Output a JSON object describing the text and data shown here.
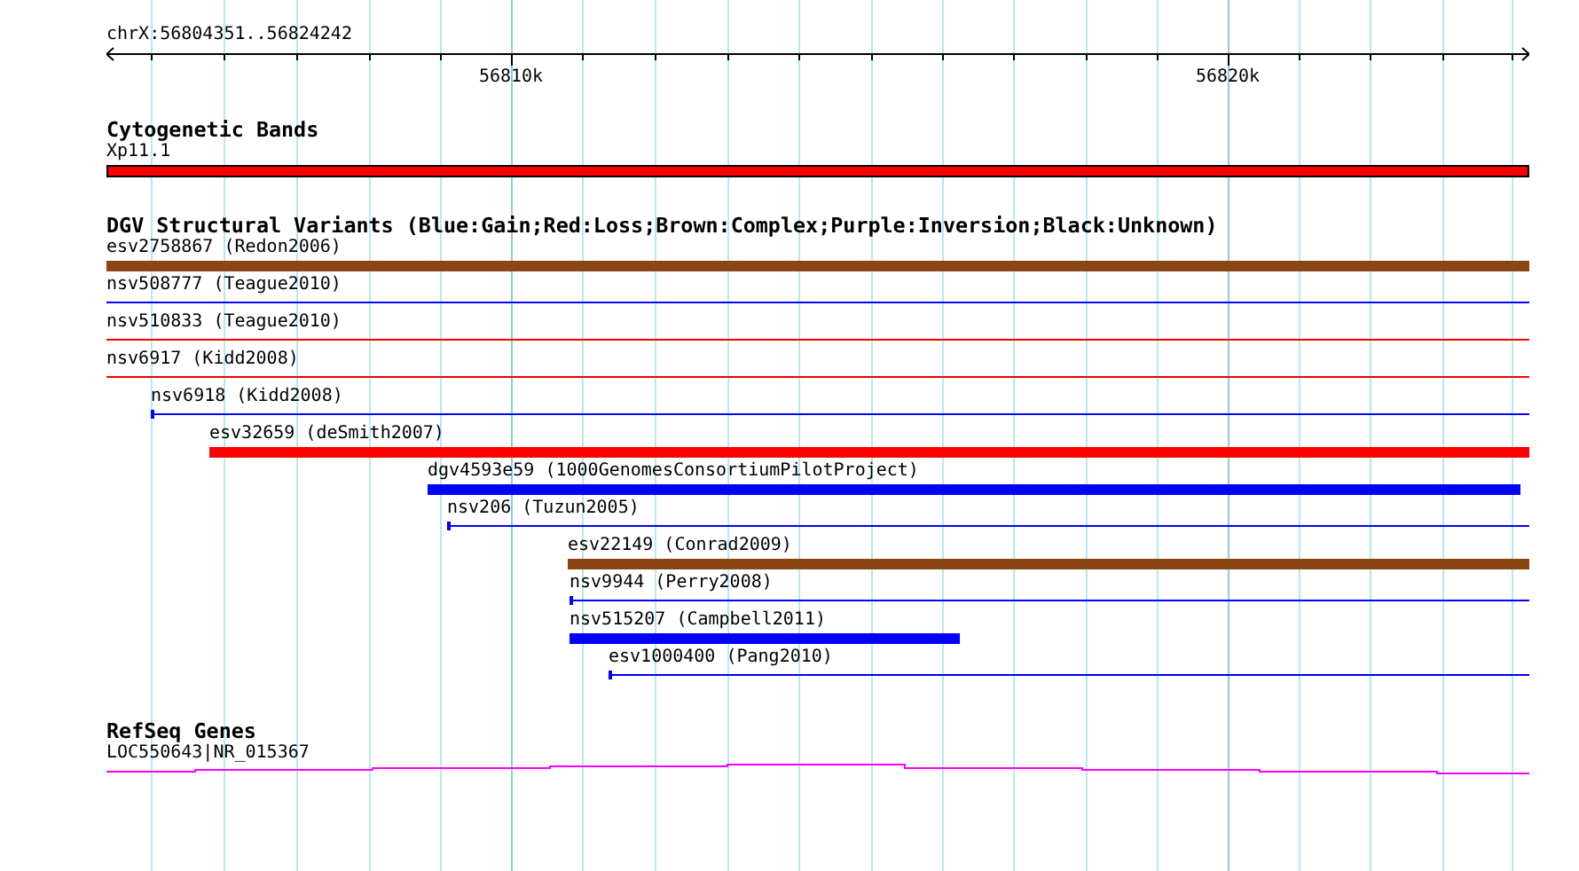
{
  "ruler": {
    "label": "chrX:56804351..56824242",
    "ticks": [
      "56810k",
      "56820k"
    ]
  },
  "tracks": [
    {
      "title": "Cytogenetic Bands",
      "features": [
        {
          "label": "Xp11.1",
          "kind": "band",
          "color": "#ff0000"
        }
      ]
    },
    {
      "title": "DGV Structural Variants (Blue:Gain;Red:Loss;Brown:Complex;Purple:Inversion;Black:Unknown)",
      "features": [
        {
          "label": "esv2758867 (Redon2006)",
          "kind": "bar",
          "color": "#8b4513"
        },
        {
          "label": "nsv508777 (Teague2010)",
          "kind": "line",
          "color": "#0000ff"
        },
        {
          "label": "nsv510833 (Teague2010)",
          "kind": "line",
          "color": "#ff0000"
        },
        {
          "label": "nsv6917 (Kidd2008)",
          "kind": "line",
          "color": "#ff0000"
        },
        {
          "label": "nsv6918 (Kidd2008)",
          "kind": "line",
          "color": "#0000ff"
        },
        {
          "label": "esv32659 (deSmith2007)",
          "kind": "bar",
          "color": "#ff0000"
        },
        {
          "label": "dgv4593e59 (1000GenomesConsortiumPilotProject)",
          "kind": "bar",
          "color": "#0000ff"
        },
        {
          "label": "nsv206 (Tuzun2005)",
          "kind": "line",
          "color": "#0000ff"
        },
        {
          "label": "esv22149 (Conrad2009)",
          "kind": "bar",
          "color": "#8b4513"
        },
        {
          "label": "nsv9944 (Perry2008)",
          "kind": "line",
          "color": "#0000ff"
        },
        {
          "label": "nsv515207 (Campbell2011)",
          "kind": "bar",
          "color": "#0000ff"
        },
        {
          "label": "esv1000400 (Pang2010)",
          "kind": "line",
          "color": "#0000ff"
        }
      ]
    },
    {
      "title": "RefSeq Genes",
      "features": [
        {
          "label": "LOC550643|NR_015367",
          "kind": "gene",
          "color": "#ff00ff"
        }
      ]
    }
  ]
}
